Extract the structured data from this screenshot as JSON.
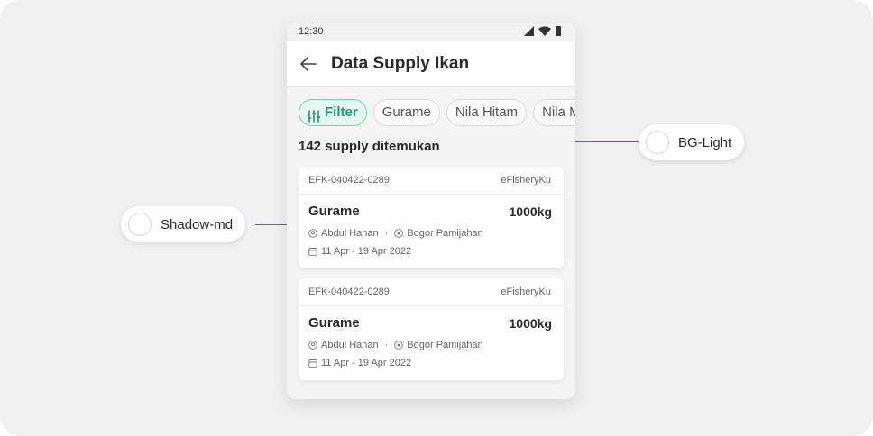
{
  "status_bar": {
    "time": "12:30"
  },
  "app_bar": {
    "title": "Data Supply Ikan"
  },
  "chips": [
    {
      "label": "Filter",
      "active": true
    },
    {
      "label": "Gurame",
      "active": false
    },
    {
      "label": "Nila Hitam",
      "active": false
    },
    {
      "label": "Nila M",
      "active": false
    }
  ],
  "result_count": "142 supply ditemukan",
  "cards": [
    {
      "id": "EFK-040422-0289",
      "source": "eFisheryKu",
      "fish": "Gurame",
      "weight": "1000kg",
      "farmer": "Abdul Hanan",
      "location": "Bogor Pamijahan",
      "date_range": "11 Apr - 19 Apr 2022"
    },
    {
      "id": "EFK-040422-0289",
      "source": "eFisheryKu",
      "fish": "Gurame",
      "weight": "1000kg",
      "farmer": "Abdul Hanan",
      "location": "Bogor Pamijahan",
      "date_range": "11 Apr - 19 Apr 2022"
    }
  ],
  "annotations": {
    "shadow": "Shadow-md",
    "background": "BG-Light"
  },
  "colors": {
    "accent": "#1f9a76",
    "accent_bg": "#e6f6f1",
    "annotation_line": "#7a4bdf"
  }
}
